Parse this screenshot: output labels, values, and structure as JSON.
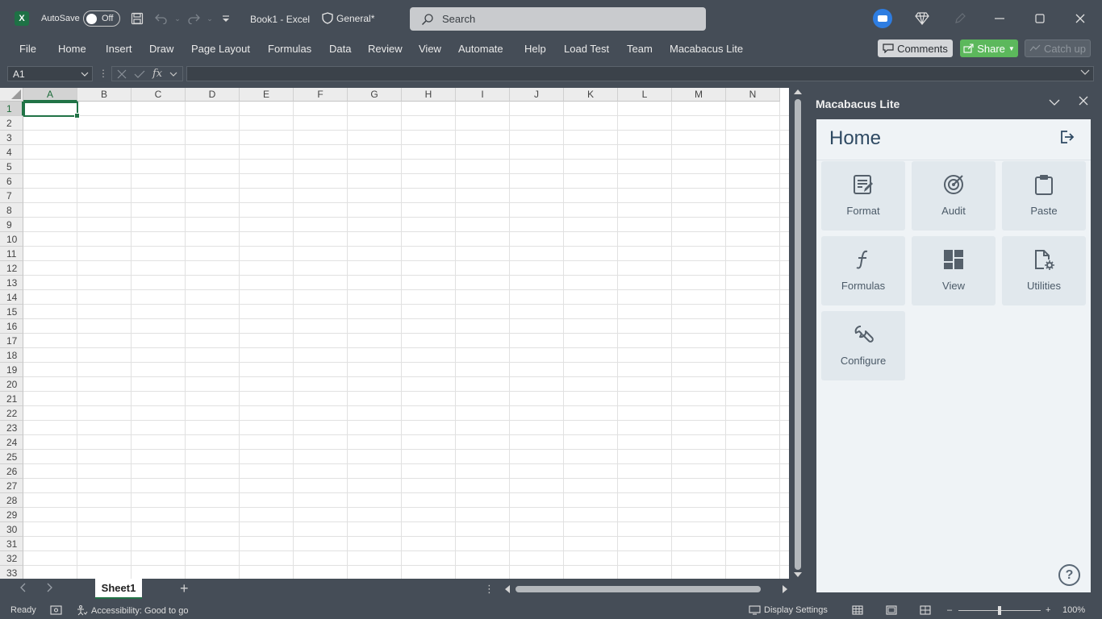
{
  "titlebar": {
    "app_badge": "X",
    "autosave_label": "AutoSave",
    "autosave_state": "Off",
    "doc_title": "Book1  -  Excel",
    "sensitivity_label": "General*",
    "search_placeholder": "Search"
  },
  "ribbon": {
    "tabs": [
      "File",
      "Home",
      "Insert",
      "Draw",
      "Page Layout",
      "Formulas",
      "Data",
      "Review",
      "View",
      "Automate",
      "Help",
      "Load Test",
      "Team",
      "Macabacus Lite"
    ],
    "comments_label": "Comments",
    "share_label": "Share",
    "catchup_label": "Catch up",
    "share_color": "#5cb85c"
  },
  "formula_bar": {
    "name_box": "A1",
    "fx_label": "fx",
    "formula_value": ""
  },
  "grid": {
    "columns": [
      "A",
      "B",
      "C",
      "D",
      "E",
      "F",
      "G",
      "H",
      "I",
      "J",
      "K",
      "L",
      "M",
      "N"
    ],
    "rows": [
      "1",
      "2",
      "3",
      "4",
      "5",
      "6",
      "7",
      "8",
      "9",
      "10",
      "11",
      "12",
      "13",
      "14",
      "15",
      "16",
      "17",
      "18",
      "19",
      "20",
      "21",
      "22",
      "23",
      "24",
      "25",
      "26",
      "27",
      "28",
      "29",
      "30",
      "31",
      "32",
      "33"
    ],
    "active_cell": "A1",
    "accent_color": "#217346"
  },
  "sheets": {
    "tabs": [
      "Sheet1"
    ],
    "active": "Sheet1"
  },
  "status": {
    "ready": "Ready",
    "accessibility": "Accessibility: Good to go",
    "display_settings": "Display Settings",
    "zoom": "100%",
    "zoom_minus": "–",
    "zoom_plus": "+"
  },
  "pane": {
    "title": "Macabacus Lite",
    "heading": "Home",
    "tiles": [
      {
        "label": "Format",
        "icon": "format-icon"
      },
      {
        "label": "Audit",
        "icon": "audit-icon"
      },
      {
        "label": "Paste",
        "icon": "paste-icon"
      },
      {
        "label": "Formulas",
        "icon": "formulas-icon"
      },
      {
        "label": "View",
        "icon": "view-icon"
      },
      {
        "label": "Utilities",
        "icon": "utilities-icon"
      },
      {
        "label": "Configure",
        "icon": "configure-icon"
      }
    ],
    "help_label": "?"
  }
}
